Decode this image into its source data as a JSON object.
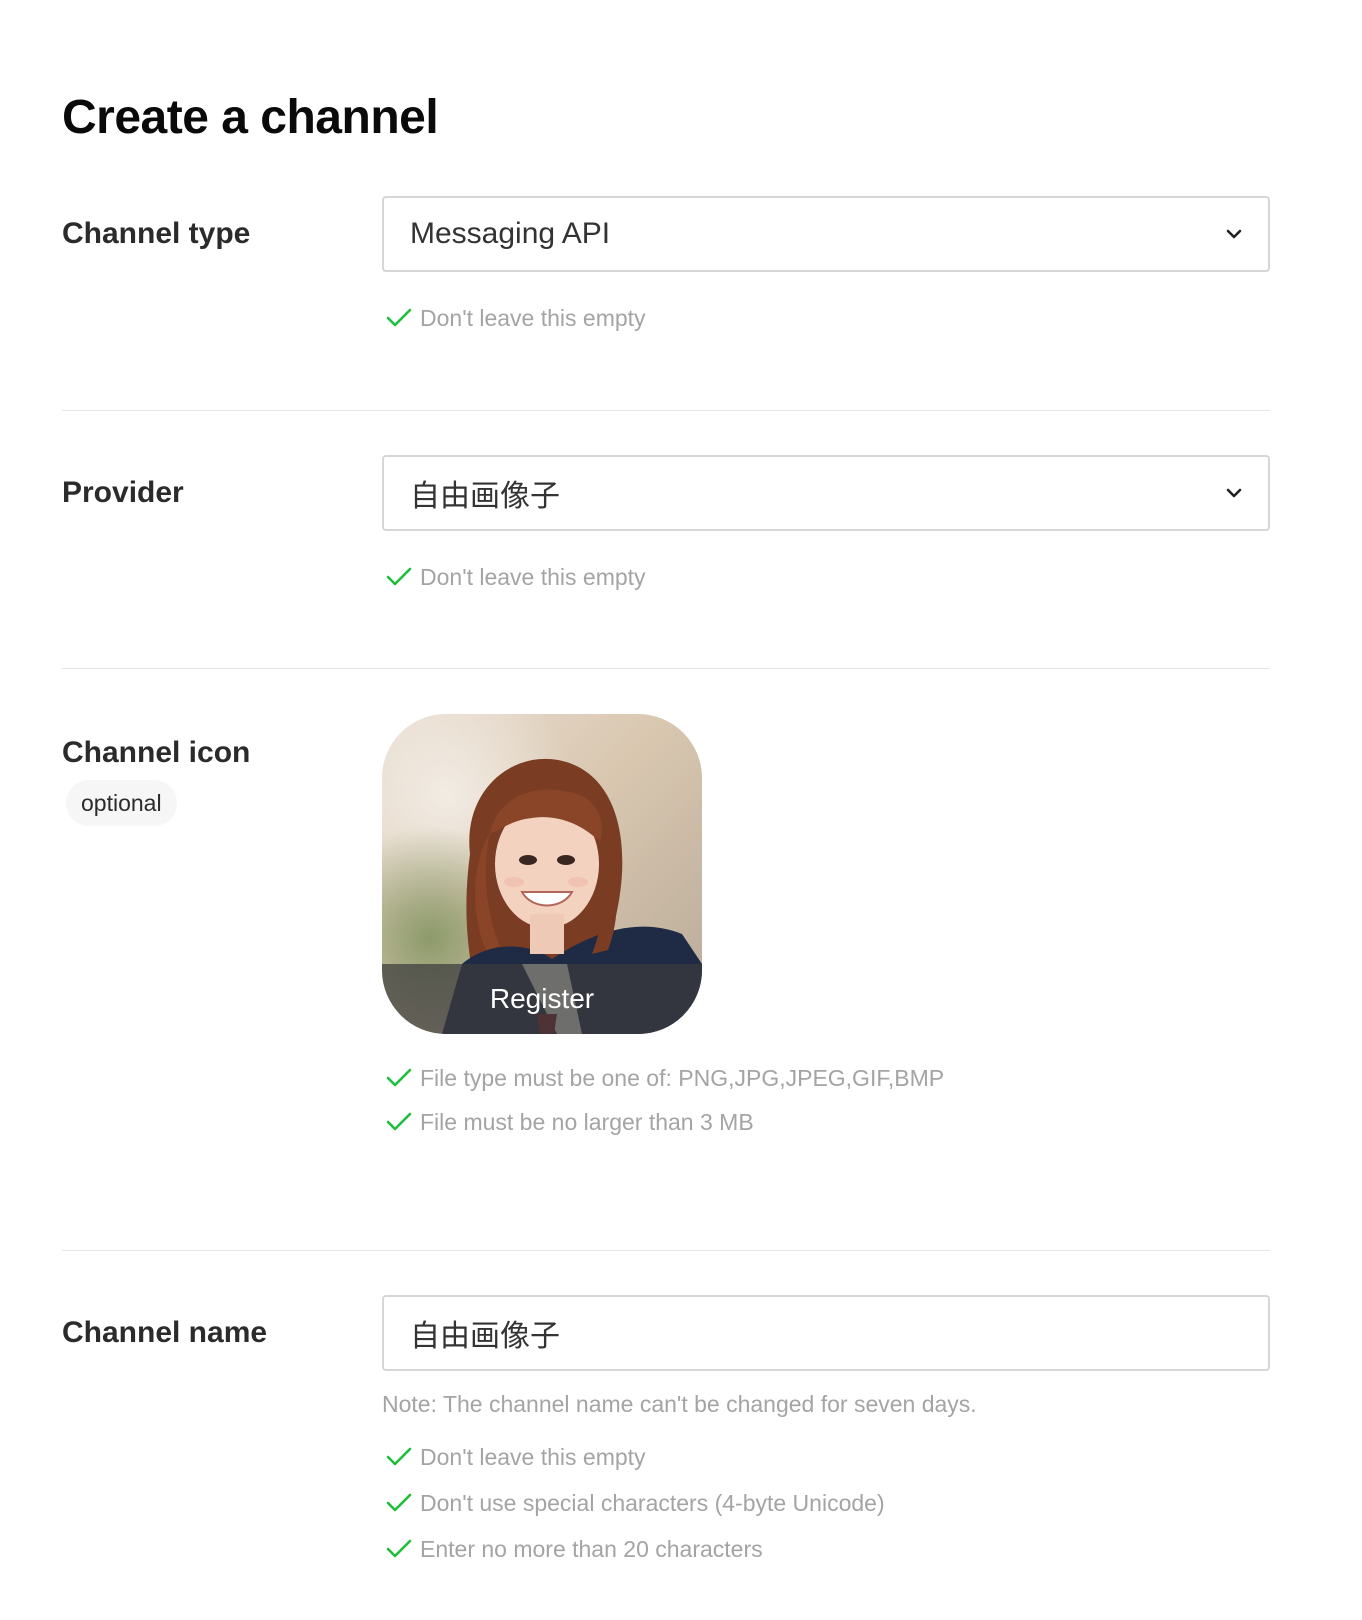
{
  "page": {
    "title": "Create a channel"
  },
  "channel_type": {
    "label": "Channel type",
    "selected": "Messaging API",
    "checks": [
      "Don't leave this empty"
    ]
  },
  "provider": {
    "label": "Provider",
    "selected": "自由画像子",
    "checks": [
      "Don't leave this empty"
    ]
  },
  "channel_icon": {
    "label": "Channel icon",
    "optional_badge": "optional",
    "register_label": "Register",
    "checks": [
      "File type must be one of: PNG,JPG,JPEG,GIF,BMP",
      "File must be no larger than 3 MB"
    ]
  },
  "channel_name": {
    "label": "Channel name",
    "value": "自由画像子",
    "note": "Note: The channel name can't be changed for seven days.",
    "checks": [
      "Don't leave this empty",
      "Don't use special characters (4-byte Unicode)",
      "Enter no more than 20 characters"
    ]
  },
  "colors": {
    "check_green": "#1dbf3a",
    "hint_gray": "#a4a4a4",
    "border_gray": "#d6d6d6",
    "divider_gray": "#e6e6e6"
  },
  "icons": {
    "dropdown": "chevron-down-icon",
    "valid": "check-icon"
  }
}
